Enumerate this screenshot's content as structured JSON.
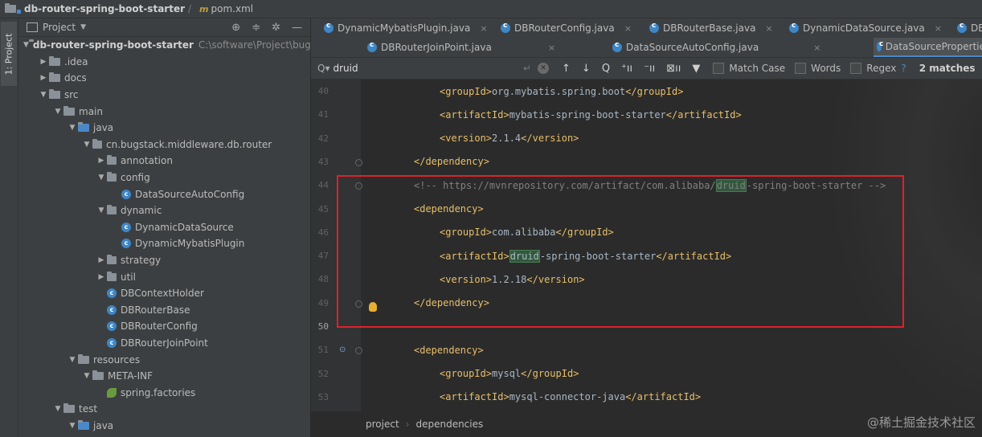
{
  "breadcrumb": {
    "project": "db-router-spring-boot-starter",
    "file": "pom.xml",
    "file_prefix": "m"
  },
  "leftstrip": {
    "tab": "1: Project"
  },
  "project_panel": {
    "title": "Project",
    "tree": [
      {
        "label": "db-router-spring-boot-starter",
        "path": "C:\\software\\Project\\bugs",
        "indent": 0,
        "kind": "module",
        "open": true,
        "bold": true
      },
      {
        "label": ".idea",
        "indent": 1,
        "kind": "folder",
        "open": false
      },
      {
        "label": "docs",
        "indent": 1,
        "kind": "folder",
        "open": false
      },
      {
        "label": "src",
        "indent": 1,
        "kind": "folder",
        "open": true
      },
      {
        "label": "main",
        "indent": 2,
        "kind": "folder",
        "open": true
      },
      {
        "label": "java",
        "indent": 3,
        "kind": "srcfolder",
        "open": true
      },
      {
        "label": "cn.bugstack.middleware.db.router",
        "indent": 4,
        "kind": "package",
        "open": true
      },
      {
        "label": "annotation",
        "indent": 5,
        "kind": "package",
        "open": false
      },
      {
        "label": "config",
        "indent": 5,
        "kind": "package",
        "open": true
      },
      {
        "label": "DataSourceAutoConfig",
        "indent": 6,
        "kind": "class"
      },
      {
        "label": "dynamic",
        "indent": 5,
        "kind": "package",
        "open": true
      },
      {
        "label": "DynamicDataSource",
        "indent": 6,
        "kind": "class"
      },
      {
        "label": "DynamicMybatisPlugin",
        "indent": 6,
        "kind": "class"
      },
      {
        "label": "strategy",
        "indent": 5,
        "kind": "package",
        "open": false
      },
      {
        "label": "util",
        "indent": 5,
        "kind": "package",
        "open": false
      },
      {
        "label": "DBContextHolder",
        "indent": 5,
        "kind": "class"
      },
      {
        "label": "DBRouterBase",
        "indent": 5,
        "kind": "class"
      },
      {
        "label": "DBRouterConfig",
        "indent": 5,
        "kind": "class"
      },
      {
        "label": "DBRouterJoinPoint",
        "indent": 5,
        "kind": "class"
      },
      {
        "label": "resources",
        "indent": 3,
        "kind": "resfolder",
        "open": true
      },
      {
        "label": "META-INF",
        "indent": 4,
        "kind": "folder",
        "open": true
      },
      {
        "label": "spring.factories",
        "indent": 5,
        "kind": "spring"
      },
      {
        "label": "test",
        "indent": 2,
        "kind": "folder",
        "open": true
      },
      {
        "label": "java",
        "indent": 3,
        "kind": "srcfolder",
        "open": true
      }
    ]
  },
  "tabs_row1": [
    {
      "label": "DynamicMybatisPlugin.java"
    },
    {
      "label": "DBRouterConfig.java"
    },
    {
      "label": "DBRouterBase.java"
    },
    {
      "label": "DynamicDataSource.java"
    },
    {
      "label": "DB"
    }
  ],
  "tabs_row2": [
    {
      "label": "DBRouterJoinPoint.java"
    },
    {
      "label": "DataSourceAutoConfig.java"
    },
    {
      "label": "DataSourcePropertie"
    }
  ],
  "search": {
    "query": "druid",
    "match_case": "Match Case",
    "words": "Words",
    "regex": "Regex",
    "help": "?",
    "matches": "2 matches"
  },
  "code_lines": [
    {
      "n": "40",
      "parts": [
        [
          "tg",
          "<groupId>"
        ],
        [
          "tx",
          "org.mybatis.spring.boot"
        ],
        [
          "tg",
          "</groupId>"
        ]
      ],
      "indent": 2
    },
    {
      "n": "41",
      "parts": [
        [
          "tg",
          "<artifactId>"
        ],
        [
          "tx",
          "mybatis-spring-boot-starter"
        ],
        [
          "tg",
          "</artifactId>"
        ]
      ],
      "indent": 2
    },
    {
      "n": "42",
      "parts": [
        [
          "tg",
          "<version>"
        ],
        [
          "tx",
          "2.1.4"
        ],
        [
          "tg",
          "</version>"
        ]
      ],
      "indent": 2
    },
    {
      "n": "43",
      "parts": [
        [
          "tg",
          "</dependency>"
        ]
      ],
      "indent": 1
    },
    {
      "n": "44",
      "parts": [
        [
          "cm",
          "<!-- https://mvnrepository.com/artifact/com.alibaba/"
        ],
        [
          "cmhl",
          "druid"
        ],
        [
          "cm",
          "-spring-boot-starter -->"
        ]
      ],
      "indent": 1
    },
    {
      "n": "45",
      "parts": [
        [
          "tg",
          "<dependency>"
        ]
      ],
      "indent": 1
    },
    {
      "n": "46",
      "parts": [
        [
          "tg",
          "<groupId>"
        ],
        [
          "tx",
          "com.alibaba"
        ],
        [
          "tg",
          "</groupId>"
        ]
      ],
      "indent": 2
    },
    {
      "n": "47",
      "parts": [
        [
          "tg",
          "<artifactId>"
        ],
        [
          "txhl",
          "druid"
        ],
        [
          "tx",
          "-spring-boot-starter"
        ],
        [
          "tg",
          "</artifactId>"
        ]
      ],
      "indent": 2
    },
    {
      "n": "48",
      "parts": [
        [
          "tg",
          "<version>"
        ],
        [
          "tx",
          "1.2.18"
        ],
        [
          "tg",
          "</version>"
        ]
      ],
      "indent": 2
    },
    {
      "n": "49",
      "parts": [
        [
          "tg",
          "</dependency>"
        ]
      ],
      "indent": 1
    },
    {
      "n": "50",
      "parts": [],
      "indent": 0,
      "current": true
    },
    {
      "n": "51",
      "parts": [
        [
          "tg",
          "<dependency>"
        ]
      ],
      "indent": 1
    },
    {
      "n": "52",
      "parts": [
        [
          "tg",
          "<groupId>"
        ],
        [
          "tx",
          "mysql"
        ],
        [
          "tg",
          "</groupId>"
        ]
      ],
      "indent": 2
    },
    {
      "n": "53",
      "parts": [
        [
          "tg",
          "<artifactId>"
        ],
        [
          "tx",
          "mysql-connector-java"
        ],
        [
          "tg",
          "</artifactId>"
        ]
      ],
      "indent": 2
    }
  ],
  "bottom_breadcrumb": [
    "project",
    "dependencies"
  ],
  "watermark": "@稀土掘金技术社区"
}
